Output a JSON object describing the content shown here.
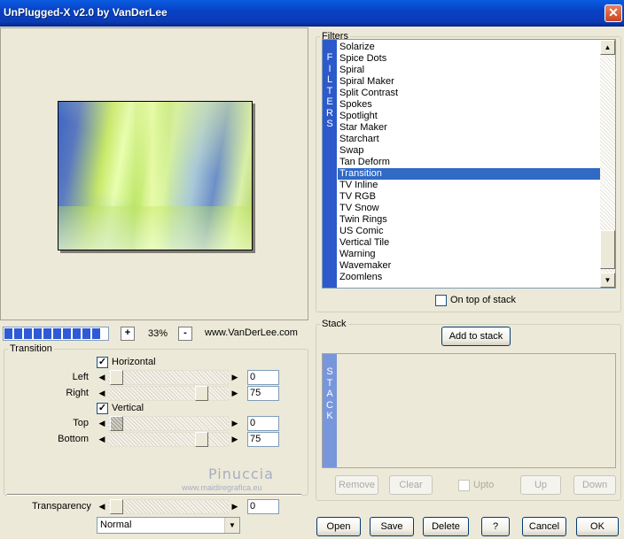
{
  "window": {
    "title": "UnPlugged-X v2.0 by VanDerLee",
    "close": "✕"
  },
  "zoom": {
    "minus": "-",
    "plus": "+",
    "value": "33%",
    "website": "www.VanDerLee.com"
  },
  "progress": {
    "segments": 10
  },
  "transition": {
    "legend": "Transition",
    "horizontal": {
      "checked": true,
      "label": "Horizontal"
    },
    "vertical": {
      "checked": true,
      "label": "Vertical"
    },
    "left": {
      "label": "Left",
      "value": "0"
    },
    "right": {
      "label": "Right",
      "value": "75"
    },
    "top": {
      "label": "Top",
      "value": "0"
    },
    "bottom": {
      "label": "Bottom",
      "value": "75"
    }
  },
  "transparency": {
    "label": "Transparency",
    "value": "0",
    "mode": "Normal"
  },
  "watermark": {
    "name": "Pinuccia",
    "site": "www.maidiregrafica.eu"
  },
  "filters": {
    "legend": "Filters",
    "sidebar": "FILTERS",
    "items": [
      "Solarize",
      "Spice Dots",
      "Spiral",
      "Spiral Maker",
      "Split Contrast",
      "Spokes",
      "Spotlight",
      "Star Maker",
      "Starchart",
      "Swap",
      "Tan Deform",
      "Transition",
      "TV Inline",
      "TV RGB",
      "TV Snow",
      "Twin Rings",
      "US Comic",
      "Vertical Tile",
      "Warning",
      "Wavemaker",
      "Zoomlens"
    ],
    "selected": "Transition",
    "on_top": {
      "checked": false,
      "label": "On top of stack"
    }
  },
  "stack": {
    "legend": "Stack",
    "add_label": "Add to stack",
    "sidebar": "STACK",
    "remove": "Remove",
    "clear": "Clear",
    "upto": "Upto",
    "up": "Up",
    "down": "Down"
  },
  "footer": {
    "open": "Open",
    "save": "Save",
    "delete": "Delete",
    "help": "?",
    "cancel": "Cancel",
    "ok": "OK"
  }
}
